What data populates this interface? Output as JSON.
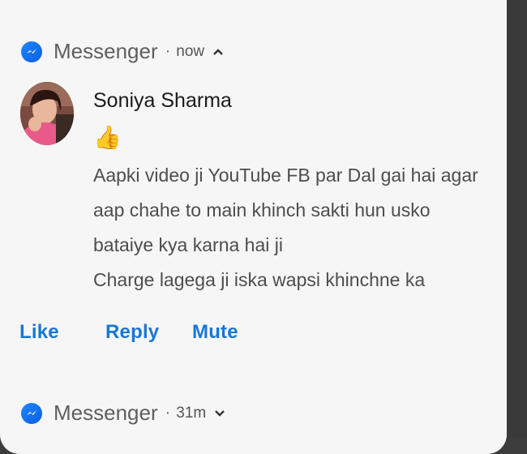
{
  "notification1": {
    "app_name": "Messenger",
    "separator": "·",
    "time": "now",
    "sender": "Soniya Sharma",
    "sticker": "👍",
    "message_lines": [
      "Aapki video ji YouTube FB par Dal gai hai agar",
      "aap chahe to main khinch sakti hun usko",
      "bataiye kya karna hai ji",
      "Charge lagega ji iska wapsi khinchne ka"
    ],
    "actions": {
      "like": "Like",
      "reply": "Reply",
      "mute": "Mute"
    }
  },
  "notification2": {
    "app_name": "Messenger",
    "separator": "·",
    "time": "31m"
  },
  "colors": {
    "accent": "#1877d6",
    "messenger_blue": "#1f86ff",
    "card_bg": "#f6f6f6"
  },
  "icons": {
    "app": "messenger-icon",
    "collapse": "chevron-up-icon",
    "expand": "chevron-down-icon"
  }
}
